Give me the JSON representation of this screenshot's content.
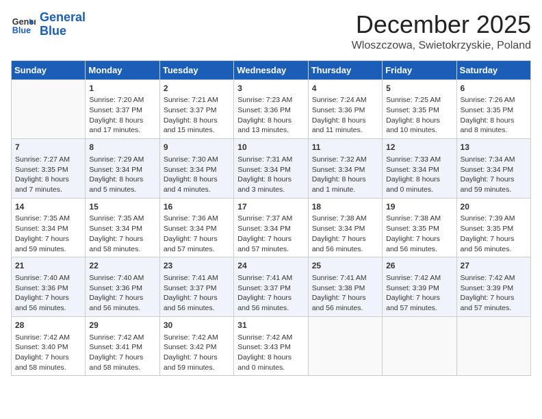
{
  "logo": {
    "line1": "General",
    "line2": "Blue"
  },
  "title": "December 2025",
  "subtitle": "Wloszczowa, Swietokrzyskie, Poland",
  "days_of_week": [
    "Sunday",
    "Monday",
    "Tuesday",
    "Wednesday",
    "Thursday",
    "Friday",
    "Saturday"
  ],
  "weeks": [
    [
      {
        "day": "",
        "detail": ""
      },
      {
        "day": "1",
        "detail": "Sunrise: 7:20 AM\nSunset: 3:37 PM\nDaylight: 8 hours\nand 17 minutes."
      },
      {
        "day": "2",
        "detail": "Sunrise: 7:21 AM\nSunset: 3:37 PM\nDaylight: 8 hours\nand 15 minutes."
      },
      {
        "day": "3",
        "detail": "Sunrise: 7:23 AM\nSunset: 3:36 PM\nDaylight: 8 hours\nand 13 minutes."
      },
      {
        "day": "4",
        "detail": "Sunrise: 7:24 AM\nSunset: 3:36 PM\nDaylight: 8 hours\nand 11 minutes."
      },
      {
        "day": "5",
        "detail": "Sunrise: 7:25 AM\nSunset: 3:35 PM\nDaylight: 8 hours\nand 10 minutes."
      },
      {
        "day": "6",
        "detail": "Sunrise: 7:26 AM\nSunset: 3:35 PM\nDaylight: 8 hours\nand 8 minutes."
      }
    ],
    [
      {
        "day": "7",
        "detail": "Sunrise: 7:27 AM\nSunset: 3:35 PM\nDaylight: 8 hours\nand 7 minutes."
      },
      {
        "day": "8",
        "detail": "Sunrise: 7:29 AM\nSunset: 3:34 PM\nDaylight: 8 hours\nand 5 minutes."
      },
      {
        "day": "9",
        "detail": "Sunrise: 7:30 AM\nSunset: 3:34 PM\nDaylight: 8 hours\nand 4 minutes."
      },
      {
        "day": "10",
        "detail": "Sunrise: 7:31 AM\nSunset: 3:34 PM\nDaylight: 8 hours\nand 3 minutes."
      },
      {
        "day": "11",
        "detail": "Sunrise: 7:32 AM\nSunset: 3:34 PM\nDaylight: 8 hours\nand 1 minute."
      },
      {
        "day": "12",
        "detail": "Sunrise: 7:33 AM\nSunset: 3:34 PM\nDaylight: 8 hours\nand 0 minutes."
      },
      {
        "day": "13",
        "detail": "Sunrise: 7:34 AM\nSunset: 3:34 PM\nDaylight: 7 hours\nand 59 minutes."
      }
    ],
    [
      {
        "day": "14",
        "detail": "Sunrise: 7:35 AM\nSunset: 3:34 PM\nDaylight: 7 hours\nand 59 minutes."
      },
      {
        "day": "15",
        "detail": "Sunrise: 7:35 AM\nSunset: 3:34 PM\nDaylight: 7 hours\nand 58 minutes."
      },
      {
        "day": "16",
        "detail": "Sunrise: 7:36 AM\nSunset: 3:34 PM\nDaylight: 7 hours\nand 57 minutes."
      },
      {
        "day": "17",
        "detail": "Sunrise: 7:37 AM\nSunset: 3:34 PM\nDaylight: 7 hours\nand 57 minutes."
      },
      {
        "day": "18",
        "detail": "Sunrise: 7:38 AM\nSunset: 3:34 PM\nDaylight: 7 hours\nand 56 minutes."
      },
      {
        "day": "19",
        "detail": "Sunrise: 7:38 AM\nSunset: 3:35 PM\nDaylight: 7 hours\nand 56 minutes."
      },
      {
        "day": "20",
        "detail": "Sunrise: 7:39 AM\nSunset: 3:35 PM\nDaylight: 7 hours\nand 56 minutes."
      }
    ],
    [
      {
        "day": "21",
        "detail": "Sunrise: 7:40 AM\nSunset: 3:36 PM\nDaylight: 7 hours\nand 56 minutes."
      },
      {
        "day": "22",
        "detail": "Sunrise: 7:40 AM\nSunset: 3:36 PM\nDaylight: 7 hours\nand 56 minutes."
      },
      {
        "day": "23",
        "detail": "Sunrise: 7:41 AM\nSunset: 3:37 PM\nDaylight: 7 hours\nand 56 minutes."
      },
      {
        "day": "24",
        "detail": "Sunrise: 7:41 AM\nSunset: 3:37 PM\nDaylight: 7 hours\nand 56 minutes."
      },
      {
        "day": "25",
        "detail": "Sunrise: 7:41 AM\nSunset: 3:38 PM\nDaylight: 7 hours\nand 56 minutes."
      },
      {
        "day": "26",
        "detail": "Sunrise: 7:42 AM\nSunset: 3:39 PM\nDaylight: 7 hours\nand 57 minutes."
      },
      {
        "day": "27",
        "detail": "Sunrise: 7:42 AM\nSunset: 3:39 PM\nDaylight: 7 hours\nand 57 minutes."
      }
    ],
    [
      {
        "day": "28",
        "detail": "Sunrise: 7:42 AM\nSunset: 3:40 PM\nDaylight: 7 hours\nand 58 minutes."
      },
      {
        "day": "29",
        "detail": "Sunrise: 7:42 AM\nSunset: 3:41 PM\nDaylight: 7 hours\nand 58 minutes."
      },
      {
        "day": "30",
        "detail": "Sunrise: 7:42 AM\nSunset: 3:42 PM\nDaylight: 7 hours\nand 59 minutes."
      },
      {
        "day": "31",
        "detail": "Sunrise: 7:42 AM\nSunset: 3:43 PM\nDaylight: 8 hours\nand 0 minutes."
      },
      {
        "day": "",
        "detail": ""
      },
      {
        "day": "",
        "detail": ""
      },
      {
        "day": "",
        "detail": ""
      }
    ]
  ]
}
